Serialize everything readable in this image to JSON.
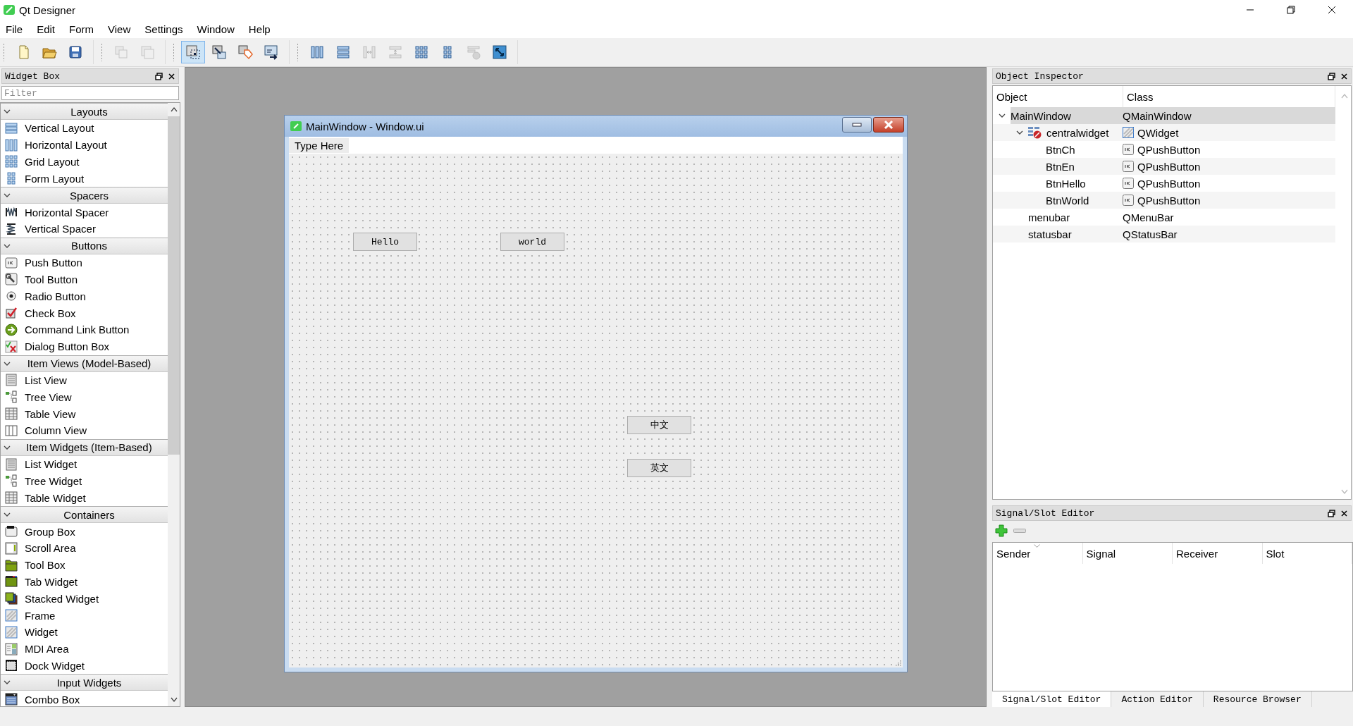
{
  "app": {
    "title": "Qt Designer"
  },
  "menu": [
    "File",
    "Edit",
    "Form",
    "View",
    "Settings",
    "Window",
    "Help"
  ],
  "toolbar": [
    [
      {
        "selected": false,
        "disabled": false
      },
      {
        "selected": false,
        "disabled": false
      },
      {
        "selected": false,
        "disabled": false
      }
    ],
    [
      {
        "selected": false,
        "disabled": true
      },
      {
        "selected": false,
        "disabled": true
      }
    ],
    [
      {
        "selected": true,
        "disabled": false
      },
      {
        "selected": false,
        "disabled": false
      },
      {
        "selected": false,
        "disabled": false
      },
      {
        "selected": false,
        "disabled": false
      }
    ],
    [
      {
        "selected": false,
        "disabled": false
      },
      {
        "selected": false,
        "disabled": false
      },
      {
        "selected": false,
        "disabled": true
      },
      {
        "selected": false,
        "disabled": true
      },
      {
        "selected": false,
        "disabled": false
      },
      {
        "selected": false,
        "disabled": false
      },
      {
        "selected": false,
        "disabled": true
      },
      {
        "selected": false,
        "disabled": false
      }
    ]
  ],
  "widget_box": {
    "title": "Widget Box",
    "filter": {
      "placeholder": "Filter"
    },
    "categories": [
      {
        "name": "Layouts",
        "expanded": true,
        "items": [
          "Vertical Layout",
          "Horizontal Layout",
          "Grid Layout",
          "Form Layout"
        ]
      },
      {
        "name": "Spacers",
        "expanded": true,
        "items": [
          "Horizontal Spacer",
          "Vertical Spacer"
        ]
      },
      {
        "name": "Buttons",
        "expanded": true,
        "items": [
          "Push Button",
          "Tool Button",
          "Radio Button",
          "Check Box",
          "Command Link Button",
          "Dialog Button Box"
        ]
      },
      {
        "name": "Item Views (Model-Based)",
        "expanded": true,
        "items": [
          "List View",
          "Tree View",
          "Table View",
          "Column View"
        ]
      },
      {
        "name": "Item Widgets (Item-Based)",
        "expanded": true,
        "items": [
          "List Widget",
          "Tree Widget",
          "Table Widget"
        ]
      },
      {
        "name": "Containers",
        "expanded": true,
        "items": [
          "Group Box",
          "Scroll Area",
          "Tool Box",
          "Tab Widget",
          "Stacked Widget",
          "Frame",
          "Widget",
          "MDI Area",
          "Dock Widget"
        ]
      },
      {
        "name": "Input Widgets",
        "expanded": true,
        "items": [
          "Combo Box"
        ]
      }
    ]
  },
  "form_window": {
    "title": "MainWindow - Window.ui",
    "menu_placeholder": "Type Here",
    "buttons": [
      "Hello",
      "world",
      "中文",
      "英文"
    ]
  },
  "object_inspector": {
    "title": "Object Inspector",
    "columns": [
      "Object",
      "Class"
    ],
    "tree": [
      {
        "object": "MainWindow",
        "class": "QMainWindow",
        "selected": true,
        "expanded": true,
        "children": [
          {
            "object": "centralwidget",
            "class": "QWidget",
            "kind": "widget",
            "selected": false,
            "expanded": true,
            "children": [
              {
                "object": "BtnCh",
                "class": "QPushButton",
                "kind": "button",
                "selected": false
              },
              {
                "object": "BtnEn",
                "class": "QPushButton",
                "kind": "button",
                "selected": false
              },
              {
                "object": "BtnHello",
                "class": "QPushButton",
                "kind": "button",
                "selected": false
              },
              {
                "object": "BtnWorld",
                "class": "QPushButton",
                "kind": "button",
                "selected": false
              }
            ]
          },
          {
            "object": "menubar",
            "class": "QMenuBar",
            "selected": false
          },
          {
            "object": "statusbar",
            "class": "QStatusBar",
            "selected": false
          }
        ]
      }
    ]
  },
  "signal_slot_editor": {
    "title": "Signal/Slot Editor",
    "columns": [
      "Sender",
      "Signal",
      "Receiver",
      "Slot"
    ]
  },
  "bottom_tabs": [
    {
      "label": "Signal/Slot Editor",
      "selected": true
    },
    {
      "label": "Action Editor",
      "selected": false
    },
    {
      "label": "Resource Browser",
      "selected": false
    }
  ]
}
